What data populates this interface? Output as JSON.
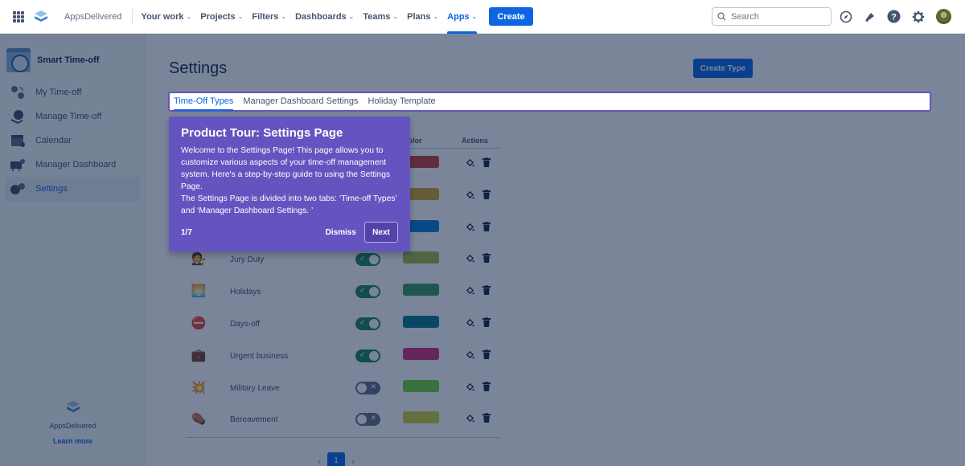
{
  "topnav": {
    "brand": "AppsDelivered",
    "items": [
      {
        "label": "Your work",
        "active": false
      },
      {
        "label": "Projects",
        "active": false
      },
      {
        "label": "Filters",
        "active": false
      },
      {
        "label": "Dashboards",
        "active": false
      },
      {
        "label": "Teams",
        "active": false
      },
      {
        "label": "Plans",
        "active": false
      },
      {
        "label": "Apps",
        "active": true
      }
    ],
    "create_label": "Create",
    "search_placeholder": "Search",
    "icons": [
      "compass-icon",
      "notification-bell-icon",
      "help-icon",
      "settings-gear-icon"
    ]
  },
  "sidebar": {
    "app_name": "Smart Time-off",
    "items": [
      {
        "label": "My Time-off",
        "active": false
      },
      {
        "label": "Manage Time-off",
        "active": false
      },
      {
        "label": "Calendar",
        "active": false
      },
      {
        "label": "Manager Dashboard",
        "active": false
      },
      {
        "label": "Settings",
        "active": true
      }
    ],
    "footer": {
      "brand": "AppsDelivered",
      "link": "Learn more"
    }
  },
  "main": {
    "title": "Settings",
    "create_type_label": "Create Type",
    "tabs": [
      {
        "label": "Time-Off Types",
        "active": true
      },
      {
        "label": "Manager Dashboard Settings",
        "active": false
      },
      {
        "label": "Holiday Template",
        "active": false
      }
    ],
    "table": {
      "headers": {
        "color": "Color",
        "actions": "Actions"
      },
      "rows": [
        {
          "emoji": "",
          "name": "",
          "enabled": true,
          "color": "#c9403a"
        },
        {
          "emoji": "",
          "name": "",
          "enabled": true,
          "color": "#d4a72c"
        },
        {
          "emoji": "",
          "name": "",
          "enabled": true,
          "color": "#0a7fd6"
        },
        {
          "emoji": "🧑‍⚖️",
          "name": "Jury Duty",
          "enabled": true,
          "color": "#a8b84a"
        },
        {
          "emoji": "🌅",
          "name": "Holidays",
          "enabled": true,
          "color": "#3a9a5c"
        },
        {
          "emoji": "⛔",
          "name": "Days-off",
          "enabled": true,
          "color": "#087a8f"
        },
        {
          "emoji": "💼",
          "name": "Urgent business",
          "enabled": true,
          "color": "#d0307a"
        },
        {
          "emoji": "💥",
          "name": "Military Leave",
          "enabled": false,
          "color": "#6fd23a"
        },
        {
          "emoji": "⚰️",
          "name": "Bereavement",
          "enabled": false,
          "color": "#cfd33a"
        }
      ]
    },
    "pagination": {
      "current": "1",
      "prev": "‹",
      "next": "›"
    }
  },
  "tour": {
    "title": "Product Tour: Settings Page",
    "body_1": "Welcome to the Settings Page! This page allows you to customize various aspects of your time-off management system. Here's a step-by-step guide to using the Settings Page.",
    "body_2": "The Settings Page is divided into two tabs: ‘Time-off Types’ and ‘Manager Dashboard Settings. ’",
    "step": "1/7",
    "dismiss_label": "Dismiss",
    "next_label": "Next",
    "accent": "#6554c0"
  }
}
